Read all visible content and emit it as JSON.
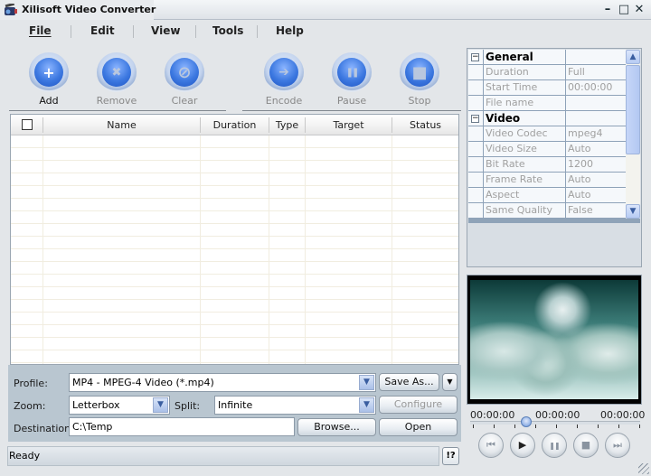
{
  "window": {
    "title": "Xilisoft Video Converter",
    "controls": {
      "minimize": "–",
      "maximize": "□",
      "close": "✕"
    }
  },
  "menu": [
    {
      "label": "File",
      "accel": "F"
    },
    {
      "label": "Edit",
      "accel": "E"
    },
    {
      "label": "View",
      "accel": "V"
    },
    {
      "label": "Tools",
      "accel": "T"
    },
    {
      "label": "Help",
      "accel": "H"
    }
  ],
  "toolbar": [
    {
      "label": "Add",
      "icon": "plus-icon",
      "glyph": "+",
      "enabled": true
    },
    {
      "label": "Remove",
      "icon": "remove-x-icon",
      "glyph": "✖",
      "enabled": false
    },
    {
      "label": "Clear",
      "icon": "clear-no-icon",
      "glyph": "⊘",
      "enabled": false
    },
    {
      "label": "Encode",
      "icon": "encode-arrow-icon",
      "glyph": "➔",
      "enabled": false
    },
    {
      "label": "Pause",
      "icon": "pause-icon",
      "glyph": "❚❚",
      "enabled": false
    },
    {
      "label": "Stop",
      "icon": "stop-icon",
      "glyph": "■",
      "enabled": false
    }
  ],
  "file_list": {
    "columns": [
      "Name",
      "Duration",
      "Type",
      "Target",
      "Status"
    ],
    "rows": []
  },
  "settings": {
    "profile_label": "Profile:",
    "profile_value": "MP4 - MPEG-4 Video  (*.mp4)",
    "save_as_label": "Save As...",
    "zoom_label": "Zoom:",
    "zoom_value": "Letterbox",
    "split_label": "Split:",
    "split_value": "Infinite",
    "configure_label": "Configure",
    "destination_label": "Destination:",
    "destination_value": "C:\\Temp",
    "browse_label": "Browse...",
    "open_label": "Open"
  },
  "status": {
    "text": "Ready",
    "help_label": "!?"
  },
  "properties": {
    "categories": [
      {
        "name": "General",
        "items": [
          {
            "name": "Duration",
            "value": "Full"
          },
          {
            "name": "Start Time",
            "value": "00:00:00"
          },
          {
            "name": "File name",
            "value": ""
          }
        ]
      },
      {
        "name": "Video",
        "items": [
          {
            "name": "Video Codec",
            "value": "mpeg4"
          },
          {
            "name": "Video Size",
            "value": "Auto"
          },
          {
            "name": "Bit Rate",
            "value": "1200"
          },
          {
            "name": "Frame Rate",
            "value": "Auto"
          },
          {
            "name": "Aspect",
            "value": "Auto"
          },
          {
            "name": "Same Quality",
            "value": "False"
          }
        ]
      }
    ]
  },
  "player": {
    "time_start": "00:00:00",
    "time_current": "00:00:00",
    "time_end": "00:00:00",
    "position_fraction": 0.33,
    "buttons": [
      {
        "name": "previous-button",
        "icon": "skip-back-icon",
        "glyph": "⏮"
      },
      {
        "name": "play-button",
        "icon": "play-icon",
        "glyph": "▶"
      },
      {
        "name": "pause-button",
        "icon": "pause-icon",
        "glyph": "❚❚"
      },
      {
        "name": "stop-button",
        "icon": "stop-icon",
        "glyph": "■"
      },
      {
        "name": "next-button",
        "icon": "skip-forward-icon",
        "glyph": "⏭"
      }
    ]
  }
}
